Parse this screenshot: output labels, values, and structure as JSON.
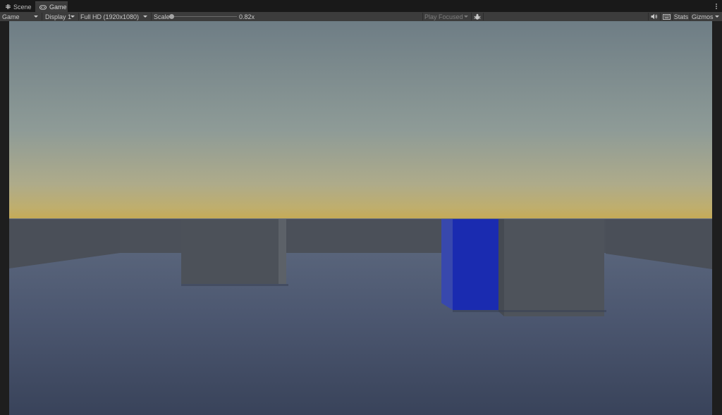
{
  "tabs": [
    {
      "label": "Scene",
      "icon": "grid-icon"
    },
    {
      "label": "Game",
      "icon": "gamepad-icon"
    }
  ],
  "toolbar": {
    "view_label": "Game",
    "display_label": "Display 1",
    "resolution_label": "Full HD (1920x1080)",
    "scale_label": "Scale",
    "scale_value": "0.82x",
    "scale_fraction": 0.0,
    "play_mode_label": "Play Focused",
    "stats_label": "Stats",
    "gizmos_label": "Gizmos",
    "icons": [
      "bug-icon",
      "speaker-icon",
      "keyboard-icon",
      "more-vert-icon"
    ]
  },
  "colors": {
    "sky_top": "#6f7e85",
    "sky_horizon": "#b2ad8a",
    "horizon_glow": "#c3a957",
    "floor_far": "#5f6a80",
    "floor_near": "#3a4458",
    "wall": "#4a4f58",
    "block_blue": "#1b2bb2",
    "block_gray": "#4f545c"
  }
}
